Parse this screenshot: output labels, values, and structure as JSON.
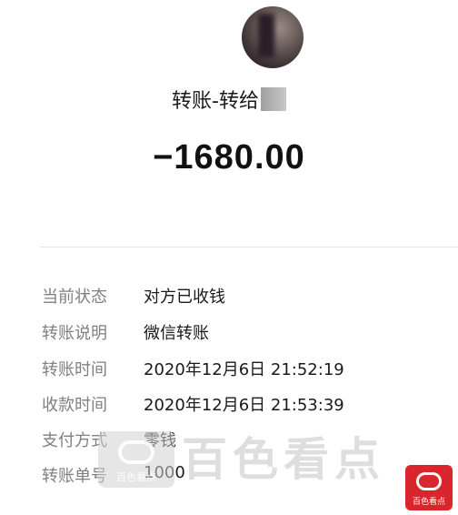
{
  "header": {
    "title": "转账-转给"
  },
  "amount": "−1680.00",
  "details": [
    {
      "label": "当前状态",
      "value": "对方已收钱"
    },
    {
      "label": "转账说明",
      "value": "微信转账"
    },
    {
      "label": "转账时间",
      "value": "2020年12月6日 21:52:19"
    },
    {
      "label": "收款时间",
      "value": "2020年12月6日 21:53:39"
    },
    {
      "label": "支付方式",
      "value": "零钱"
    },
    {
      "label": "转账单号",
      "value": "1000"
    }
  ],
  "watermark": {
    "text": "百色看点",
    "logo_text": "百色看点",
    "corner_text": "百色看点"
  },
  "colors": {
    "label": "#808080",
    "value": "#1a1a1a",
    "corner_logo": "#d9262c"
  },
  "icons": {
    "avatar": "avatar",
    "watermark_logo": "baise-kandian-logo"
  }
}
